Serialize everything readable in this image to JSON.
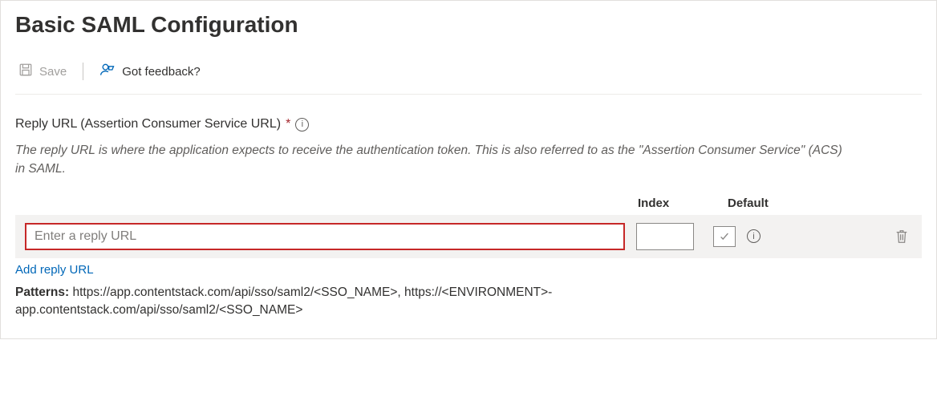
{
  "title": "Basic SAML Configuration",
  "toolbar": {
    "save_label": "Save",
    "feedback_label": "Got feedback?"
  },
  "reply_url": {
    "section_label": "Reply URL (Assertion Consumer Service URL)",
    "required_mark": "*",
    "description": "The reply URL is where the application expects to receive the authentication token. This is also referred to as the \"Assertion Consumer Service\" (ACS) in SAML.",
    "headers": {
      "index": "Index",
      "default": "Default"
    },
    "input_placeholder": "Enter a reply URL",
    "input_value": "",
    "index_value": "",
    "add_link_label": "Add reply URL",
    "patterns_label": "Patterns:",
    "patterns_text": " https://app.contentstack.com/api/sso/saml2/<SSO_NAME>, https://<ENVIRONMENT>-app.contentstack.com/api/sso/saml2/<SSO_NAME>"
  }
}
